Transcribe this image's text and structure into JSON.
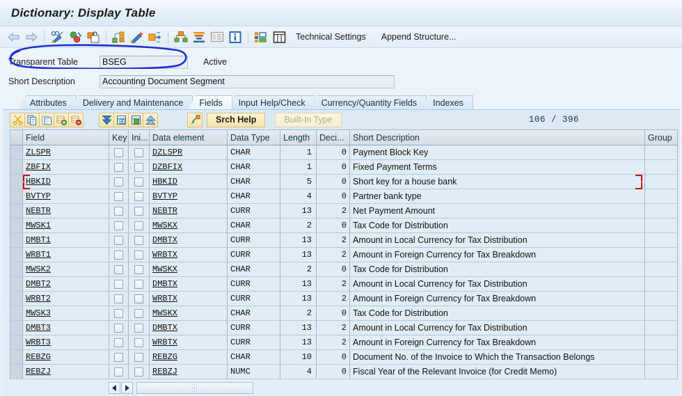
{
  "window": {
    "title": "Dictionary: Display Table"
  },
  "toolbar": {
    "icons": [
      {
        "name": "back-arrow-icon"
      },
      {
        "name": "forward-arrow-icon"
      },
      {
        "name": "display-change-icon"
      },
      {
        "name": "activate-icon"
      },
      {
        "name": "unlock-icon"
      },
      {
        "name": "hierarchy-display-icon"
      },
      {
        "name": "magic-wand-icon"
      },
      {
        "name": "where-used-list-icon"
      },
      {
        "name": "graphic-icon"
      },
      {
        "name": "indexes-icon"
      },
      {
        "name": "documentation-icon"
      },
      {
        "name": "info-icon"
      },
      {
        "name": "technical-settings-icon"
      },
      {
        "name": "table-contents-icon"
      }
    ],
    "technical_settings_label": "Technical Settings",
    "append_structure_label": "Append Structure..."
  },
  "header": {
    "table_type_label": "Transparent Table",
    "table_name": "BSEG",
    "status": "Active",
    "short_description_label": "Short Description",
    "short_description_value": "Accounting Document Segment"
  },
  "tabs": [
    {
      "label": "Attributes",
      "active": false
    },
    {
      "label": "Delivery and Maintenance",
      "active": false
    },
    {
      "label": "Fields",
      "active": true
    },
    {
      "label": "Input Help/Check",
      "active": false
    },
    {
      "label": "Currency/Quantity Fields",
      "active": false
    },
    {
      "label": "Indexes",
      "active": false
    }
  ],
  "subtoolbar": {
    "icons": [
      {
        "name": "cut-icon"
      },
      {
        "name": "copy-icon"
      },
      {
        "name": "paste-icon"
      },
      {
        "name": "insert-row-icon"
      },
      {
        "name": "delete-row-icon"
      },
      {
        "name": "expand-all-icon"
      },
      {
        "name": "append-row-icon"
      },
      {
        "name": "insert-line-icon"
      },
      {
        "name": "collapse-icon"
      },
      {
        "name": "predefined-type-icon"
      }
    ],
    "srch_help_label": "Srch Help",
    "builtin_type_label": "Built-In Type",
    "builtin_type_disabled": true,
    "counter": "106 / 396"
  },
  "grid": {
    "columns": [
      "Field",
      "Key",
      "Ini...",
      "Data element",
      "Data Type",
      "Length",
      "Deci...",
      "Short Description",
      "Group"
    ],
    "rows": [
      {
        "field": "ZLSPR",
        "key": false,
        "ini": false,
        "data_element": "DZLSPR",
        "data_type": "CHAR",
        "length": "1",
        "decimals": "0",
        "short_description": "Payment Block Key",
        "group": "",
        "selected": false
      },
      {
        "field": "ZBFIX",
        "key": false,
        "ini": false,
        "data_element": "DZBFIX",
        "data_type": "CHAR",
        "length": "1",
        "decimals": "0",
        "short_description": "Fixed Payment Terms",
        "group": "",
        "selected": false
      },
      {
        "field": "HBKID",
        "key": false,
        "ini": false,
        "data_element": "HBKID",
        "data_type": "CHAR",
        "length": "5",
        "decimals": "0",
        "short_description": "Short key for a house bank",
        "group": "",
        "selected": true
      },
      {
        "field": "BVTYP",
        "key": false,
        "ini": false,
        "data_element": "BVTYP",
        "data_type": "CHAR",
        "length": "4",
        "decimals": "0",
        "short_description": "Partner bank type",
        "group": "",
        "selected": false
      },
      {
        "field": "NEBTR",
        "key": false,
        "ini": false,
        "data_element": "NEBTR",
        "data_type": "CURR",
        "length": "13",
        "decimals": "2",
        "short_description": "Net Payment Amount",
        "group": "",
        "selected": false
      },
      {
        "field": "MWSK1",
        "key": false,
        "ini": false,
        "data_element": "MWSKX",
        "data_type": "CHAR",
        "length": "2",
        "decimals": "0",
        "short_description": "Tax Code for Distribution",
        "group": "",
        "selected": false
      },
      {
        "field": "DMBT1",
        "key": false,
        "ini": false,
        "data_element": "DMBTX",
        "data_type": "CURR",
        "length": "13",
        "decimals": "2",
        "short_description": "Amount in Local Currency for Tax Distribution",
        "group": "",
        "selected": false
      },
      {
        "field": "WRBT1",
        "key": false,
        "ini": false,
        "data_element": "WRBTX",
        "data_type": "CURR",
        "length": "13",
        "decimals": "2",
        "short_description": "Amount in Foreign Currency for Tax Breakdown",
        "group": "",
        "selected": false
      },
      {
        "field": "MWSK2",
        "key": false,
        "ini": false,
        "data_element": "MWSKX",
        "data_type": "CHAR",
        "length": "2",
        "decimals": "0",
        "short_description": "Tax Code for Distribution",
        "group": "",
        "selected": false
      },
      {
        "field": "DMBT2",
        "key": false,
        "ini": false,
        "data_element": "DMBTX",
        "data_type": "CURR",
        "length": "13",
        "decimals": "2",
        "short_description": "Amount in Local Currency for Tax Distribution",
        "group": "",
        "selected": false
      },
      {
        "field": "WRBT2",
        "key": false,
        "ini": false,
        "data_element": "WRBTX",
        "data_type": "CURR",
        "length": "13",
        "decimals": "2",
        "short_description": "Amount in Foreign Currency for Tax Breakdown",
        "group": "",
        "selected": false
      },
      {
        "field": "MWSK3",
        "key": false,
        "ini": false,
        "data_element": "MWSKX",
        "data_type": "CHAR",
        "length": "2",
        "decimals": "0",
        "short_description": "Tax Code for Distribution",
        "group": "",
        "selected": false
      },
      {
        "field": "DMBT3",
        "key": false,
        "ini": false,
        "data_element": "DMBTX",
        "data_type": "CURR",
        "length": "13",
        "decimals": "2",
        "short_description": "Amount in Local Currency for Tax Distribution",
        "group": "",
        "selected": false
      },
      {
        "field": "WRBT3",
        "key": false,
        "ini": false,
        "data_element": "WRBTX",
        "data_type": "CURR",
        "length": "13",
        "decimals": "2",
        "short_description": "Amount in Foreign Currency for Tax Breakdown",
        "group": "",
        "selected": false
      },
      {
        "field": "REBZG",
        "key": false,
        "ini": false,
        "data_element": "REBZG",
        "data_type": "CHAR",
        "length": "10",
        "decimals": "0",
        "short_description": "Document No. of the Invoice to Which the Transaction Belongs",
        "group": "",
        "selected": false
      },
      {
        "field": "REBZJ",
        "key": false,
        "ini": false,
        "data_element": "REBZJ",
        "data_type": "NUMC",
        "length": "4",
        "decimals": "0",
        "short_description": "Fiscal Year of the Relevant Invoice (for Credit Memo)",
        "group": "",
        "selected": false
      }
    ]
  },
  "scrollbar": {
    "left_arrow": "◀",
    "right_arrow": "▶"
  },
  "annotations": {
    "ellipse_color": "#1b2fd0",
    "selection_bracket_color": "#cc0000"
  }
}
